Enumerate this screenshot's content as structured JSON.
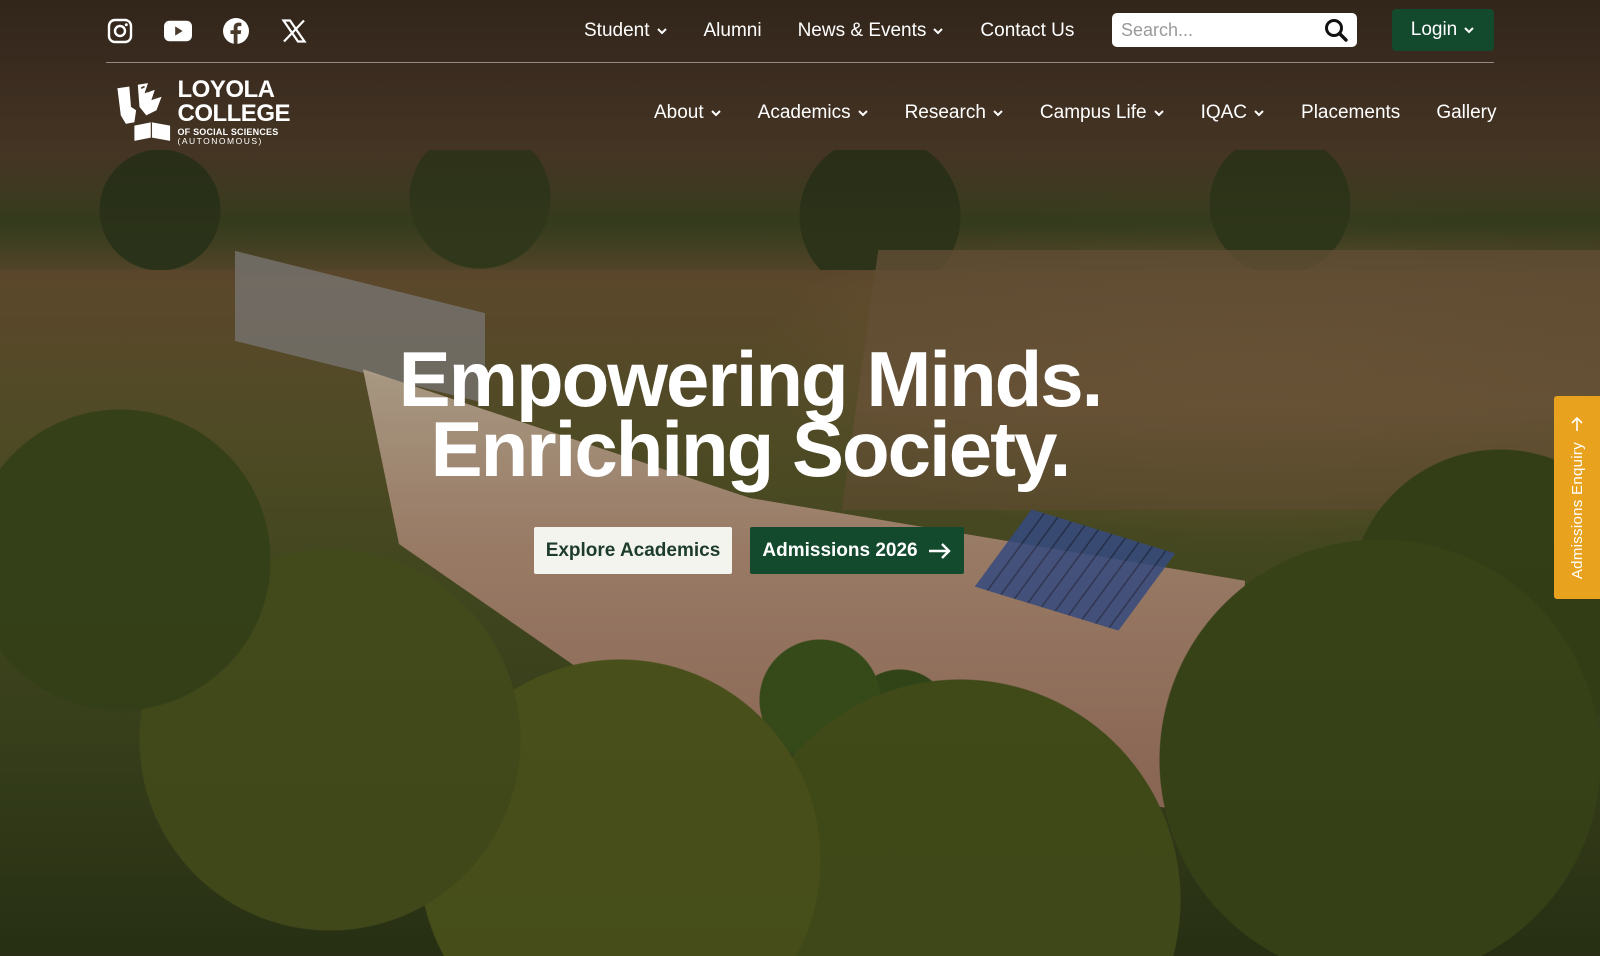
{
  "social": [
    {
      "icon": "instagram-icon"
    },
    {
      "icon": "youtube-icon"
    },
    {
      "icon": "facebook-icon"
    },
    {
      "icon": "x-twitter-icon"
    }
  ],
  "topnav": {
    "student": "Student",
    "alumni": "Alumni",
    "news_events": "News & Events",
    "contact": "Contact Us"
  },
  "search": {
    "placeholder": "Search..."
  },
  "login": {
    "label": "Login"
  },
  "logo": {
    "line1": "LOYOLA",
    "line2": "COLLEGE",
    "line3": "OF SOCIAL SCIENCES",
    "line4": "(AUTONOMOUS)"
  },
  "mainnav": {
    "about": "About",
    "academics": "Academics",
    "research": "Research",
    "campus_life": "Campus Life",
    "iqac": "IQAC",
    "placements": "Placements",
    "gallery": "Gallery"
  },
  "hero": {
    "line1": "Empowering Minds.",
    "line2": "Enriching Society."
  },
  "cta": {
    "explore": "Explore Academics",
    "admissions": "Admissions 2026"
  },
  "side_tab": {
    "label": "Admissions Enquiry"
  },
  "colors": {
    "brand_green": "#134a2e",
    "enquiry_orange": "#e9a21e",
    "light_button": "#f4f4ef"
  }
}
